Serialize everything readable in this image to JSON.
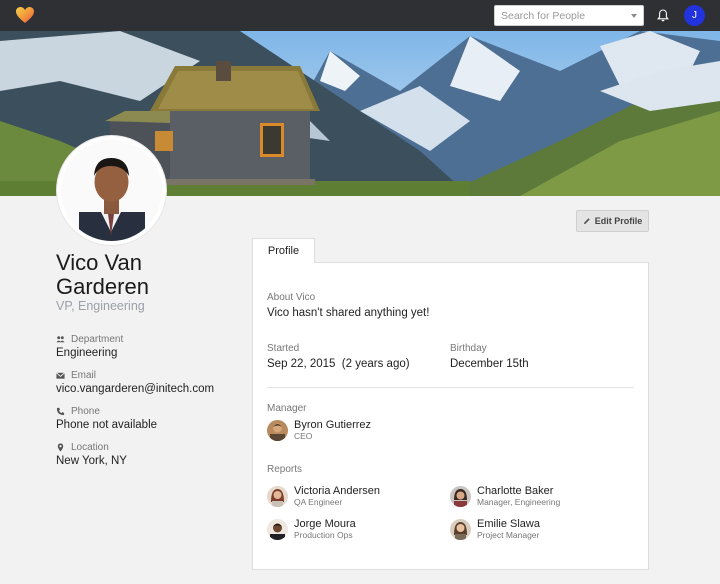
{
  "topbar": {
    "search_placeholder": "Search for People",
    "user_initial": "J"
  },
  "profile": {
    "name": "Vico Van Garderen",
    "title": "VP, Engineering",
    "edit_label": "Edit Profile",
    "department_label": "Department",
    "department": "Engineering",
    "email_label": "Email",
    "email": "vico.vangarderen@initech.com",
    "phone_label": "Phone",
    "phone": "Phone not available",
    "location_label": "Location",
    "location": "New York, NY"
  },
  "tabs": [
    {
      "label": "Profile"
    }
  ],
  "card": {
    "about_label": "About Vico",
    "about_text": "Vico hasn't shared anything yet!",
    "started_label": "Started",
    "started_value": "Sep 22, 2015  (2 years ago)",
    "birthday_label": "Birthday",
    "birthday_value": "December 15th",
    "manager_label": "Manager",
    "manager": {
      "name": "Byron Gutierrez",
      "role": "CEO"
    },
    "reports_label": "Reports",
    "reports": [
      {
        "name": "Victoria Andersen",
        "role": "QA Engineer"
      },
      {
        "name": "Charlotte Baker",
        "role": "Manager, Engineering"
      },
      {
        "name": "Jorge Moura",
        "role": "Production Ops"
      },
      {
        "name": "Emilie Slawa",
        "role": "Project Manager"
      }
    ]
  },
  "colors": {
    "topbar": "#2f3033",
    "user_avatar": "#2233dd",
    "page_bg": "#f2f2f2"
  }
}
